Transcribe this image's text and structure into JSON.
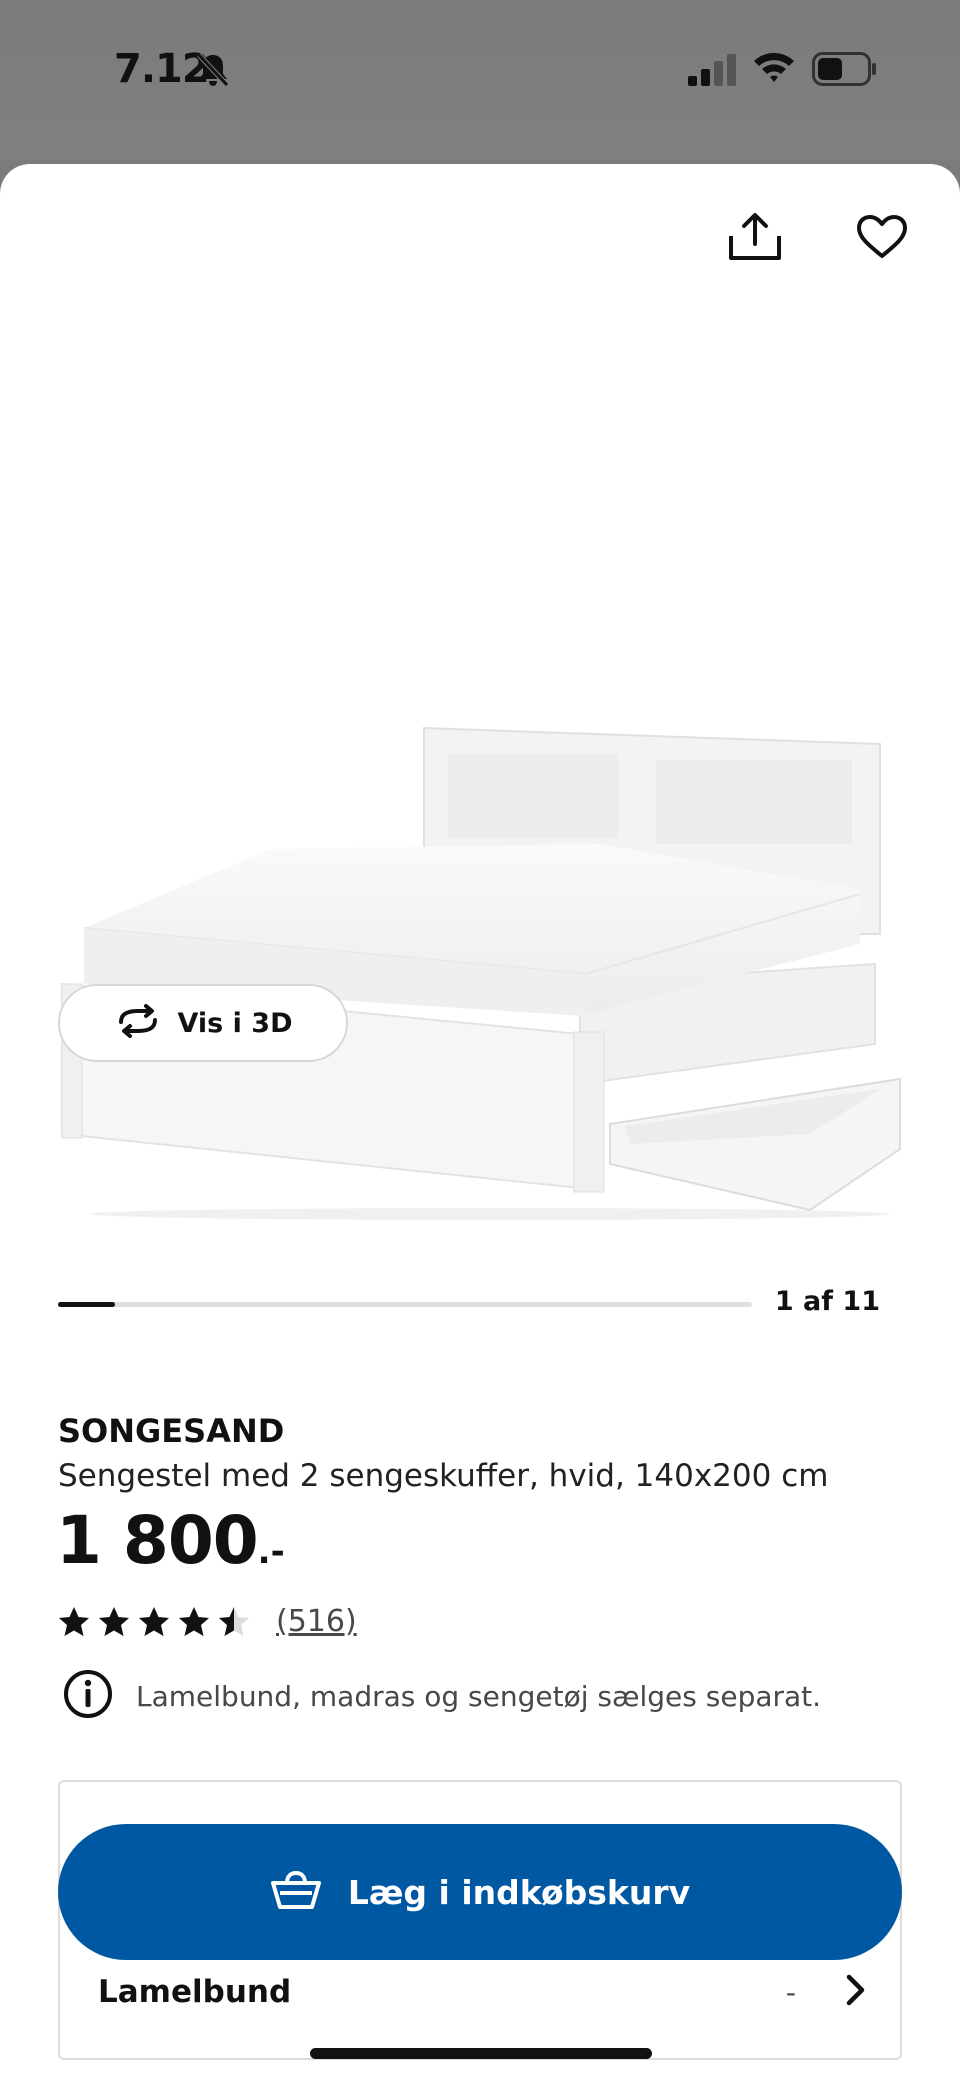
{
  "status_bar": {
    "time": "7.12",
    "icons": [
      "bell-off-icon",
      "signal-icon",
      "wifi-icon",
      "battery-icon"
    ]
  },
  "header": {
    "icons": [
      "share-icon",
      "heart-icon"
    ]
  },
  "product_image": {
    "icon": "bed-image"
  },
  "view3d": {
    "label": "Vis i 3D",
    "icon": "rotate-3d-icon"
  },
  "carousel": {
    "counter": "1 af 11",
    "current": 1,
    "total": 11
  },
  "product": {
    "name": "SONGESAND",
    "description": "Sengestel med 2 sengeskuffer, hvid, 140x200 cm",
    "price": "1 800",
    "price_suffix": ".-",
    "rating_value": 4.5,
    "rating_max": 5,
    "review_count": "(516)",
    "info_note": "Lamelbund, madras og sengetøj sælges separat."
  },
  "cart": {
    "label": "Læg i indkøbskurv",
    "icon": "basket-icon",
    "color": "#0058a3"
  },
  "options": {
    "lamel_label": "Lamelbund",
    "lamel_value": "-"
  }
}
